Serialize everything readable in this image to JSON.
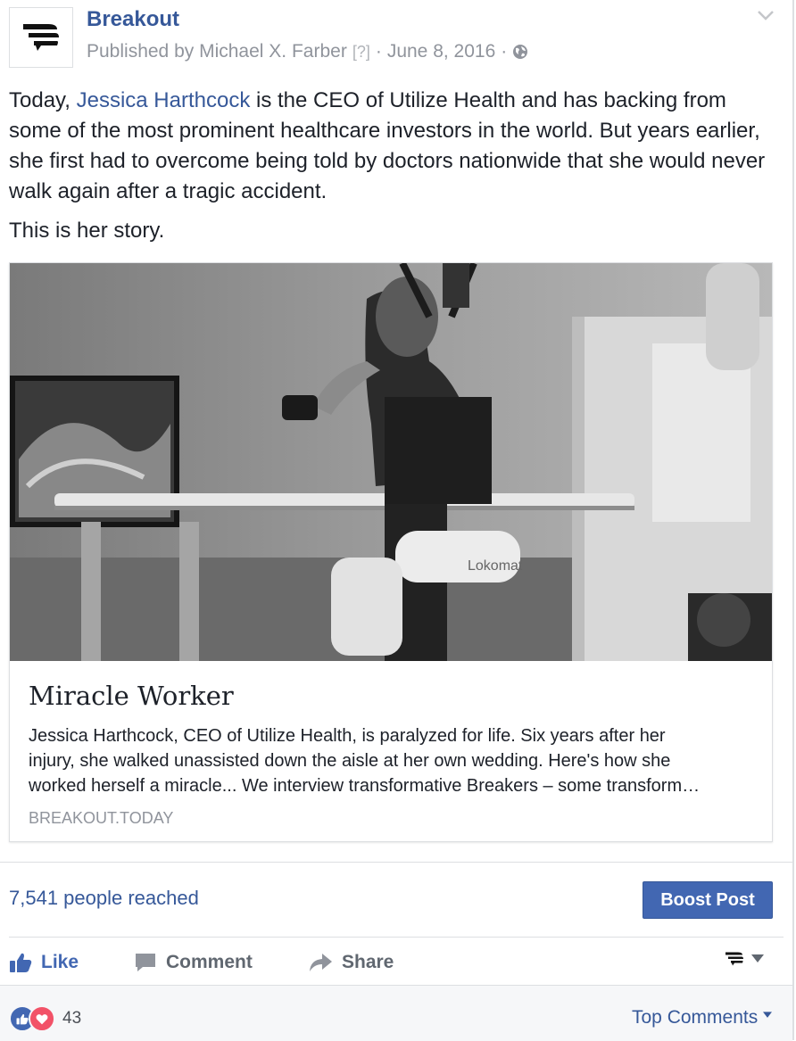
{
  "header": {
    "page_name": "Breakout",
    "published_by": "Published by Michael X. Farber",
    "info_marker": "[?]",
    "date": "June 8, 2016",
    "separator": "·"
  },
  "post": {
    "p1_before": "Today, ",
    "p1_link": "Jessica Harthcock",
    "p1_after": " is the CEO of Utilize Health and has backing from some of the most prominent healthcare investors in the world. But years earlier, she first had to overcome being told by doctors nationwide that she would never walk again after a tragic accident.",
    "p2": "This is her story."
  },
  "preview": {
    "title": "Miracle Worker",
    "desc_line1": "Jessica Harthcock, CEO of Utilize Health, is paralyzed for life. Six years after her",
    "desc_line2": "injury, she walked unassisted down the aisle at her own wedding. Here's how she",
    "desc_line3": "worked herself a miracle... We interview transformative Breakers – some transform…",
    "domain": "BREAKOUT.TODAY",
    "photo_label": "Lokomat"
  },
  "insights": {
    "reach": "7,541 people reached",
    "boost_label": "Boost Post"
  },
  "actions": {
    "like": "Like",
    "comment": "Comment",
    "share": "Share"
  },
  "footer": {
    "reaction_count": "43",
    "top_comments": "Top Comments"
  },
  "colors": {
    "link_blue": "#365899",
    "boost_blue": "#4267b2",
    "like_blue": "#4267b2",
    "love_red": "#f25268",
    "muted_gray": "#90949c"
  },
  "icons": [
    "breakout-logo-icon",
    "chevron-down-icon",
    "globe-icon",
    "thumbs-up-icon",
    "comment-icon",
    "share-icon",
    "heart-icon",
    "caret-down-icon"
  ]
}
